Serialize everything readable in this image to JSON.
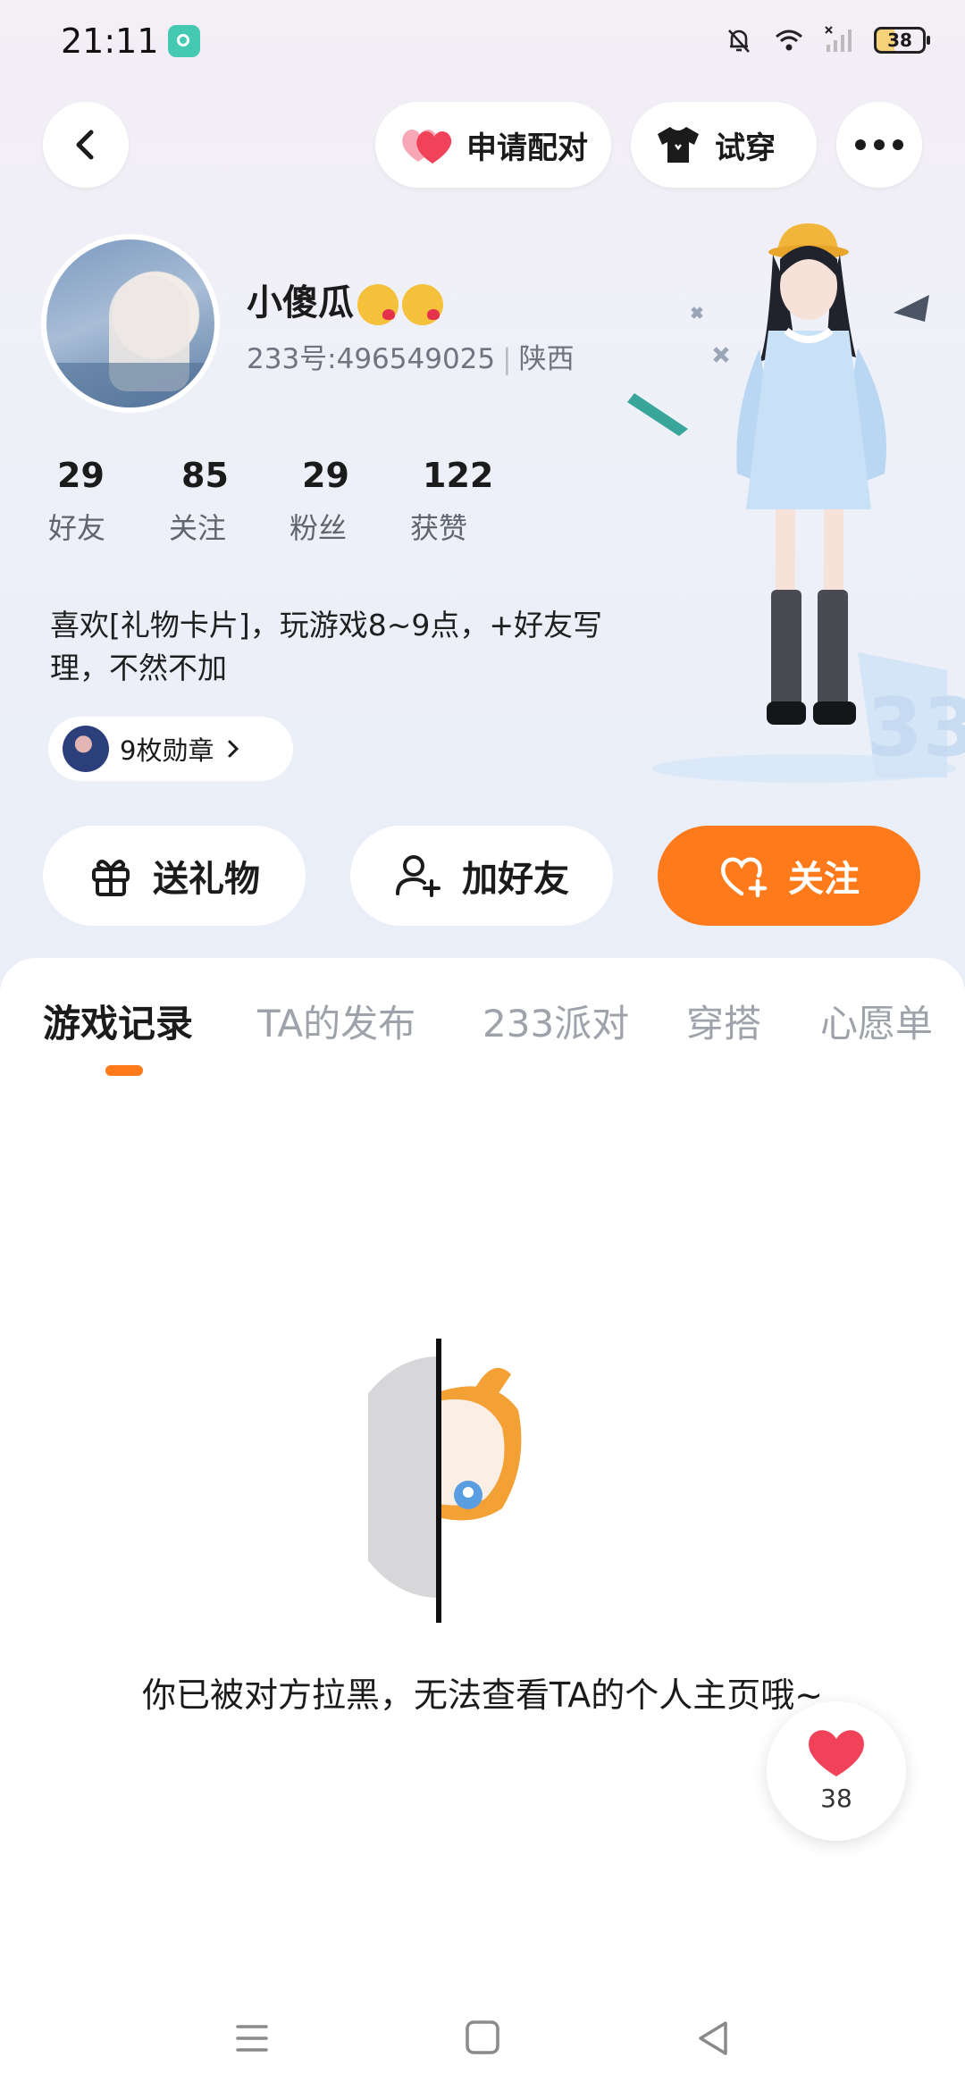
{
  "status_bar": {
    "time": "21:11",
    "battery": "38",
    "icons": [
      "mute-bell-icon",
      "wifi-icon",
      "signal-icon",
      "battery-icon"
    ]
  },
  "top_nav": {
    "back_icon": "back-arrow-icon",
    "match_label": "申请配对",
    "tryon_label": "试穿",
    "more_icon": "more-dots-icon"
  },
  "profile": {
    "nickname": "小傻瓜",
    "uid": "233号:496549025",
    "region": "陕西",
    "stats": [
      {
        "value": "29",
        "label": "好友"
      },
      {
        "value": "85",
        "label": "关注"
      },
      {
        "value": "29",
        "label": "粉丝"
      },
      {
        "value": "122",
        "label": "获赞"
      }
    ],
    "bio_line1": "喜欢[礼物卡片]，玩游戏8~9点，+好友写",
    "bio_line2": "理，不然不加",
    "medal_label": "9枚勋章"
  },
  "actions": {
    "gift_label": "送礼物",
    "add_friend_label": "加好友",
    "follow_label": "关注"
  },
  "tabs": [
    "游戏记录",
    "TA的发布",
    "233派对",
    "穿搭",
    "心愿单"
  ],
  "content": {
    "blocked_message": "你已被对方拉黑，无法查看TA的个人主页哦~"
  },
  "like": {
    "count": "38"
  },
  "colors": {
    "accent": "#ff7a1a",
    "heart": "#f0435a"
  }
}
